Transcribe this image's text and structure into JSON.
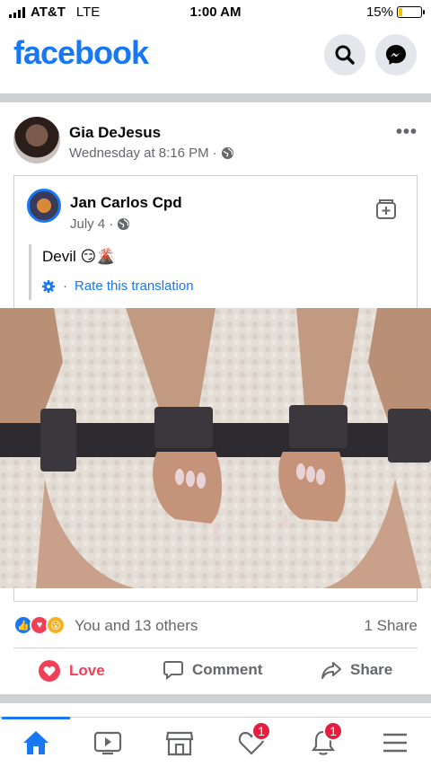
{
  "status_bar": {
    "carrier": "AT&T",
    "network": "LTE",
    "time": "1:00 AM",
    "battery": "15%",
    "battery_level": 0.15
  },
  "header": {
    "logo": "facebook",
    "search_icon": "search-icon",
    "messenger_icon": "messenger-icon",
    "brand_color": "#1877f2"
  },
  "post": {
    "author": "Gia DeJesus",
    "timestamp": "Wednesday at 8:16 PM",
    "audience": "·",
    "menu": "•••",
    "shared": {
      "author": "Jan Carlos Cpd",
      "timestamp": "July 4",
      "audience": "·",
      "text": "Devil 😏🌋",
      "translate_sep": "·",
      "translate_link": "Rate this translation"
    },
    "reactions_text": "You and 13 others",
    "shares": "1 Share",
    "actions": {
      "love": "Love",
      "comment": "Comment",
      "share": "Share"
    },
    "love_color": "#f33e58"
  },
  "bottom_nav": {
    "items": [
      {
        "name": "home",
        "icon": "home-icon"
      },
      {
        "name": "watch",
        "icon": "video-icon"
      },
      {
        "name": "marketplace",
        "icon": "shop-icon"
      },
      {
        "name": "dating",
        "icon": "heart-icon",
        "badge": "1"
      },
      {
        "name": "notifications",
        "icon": "bell-icon",
        "badge": "1"
      },
      {
        "name": "menu",
        "icon": "menu-icon"
      }
    ]
  }
}
